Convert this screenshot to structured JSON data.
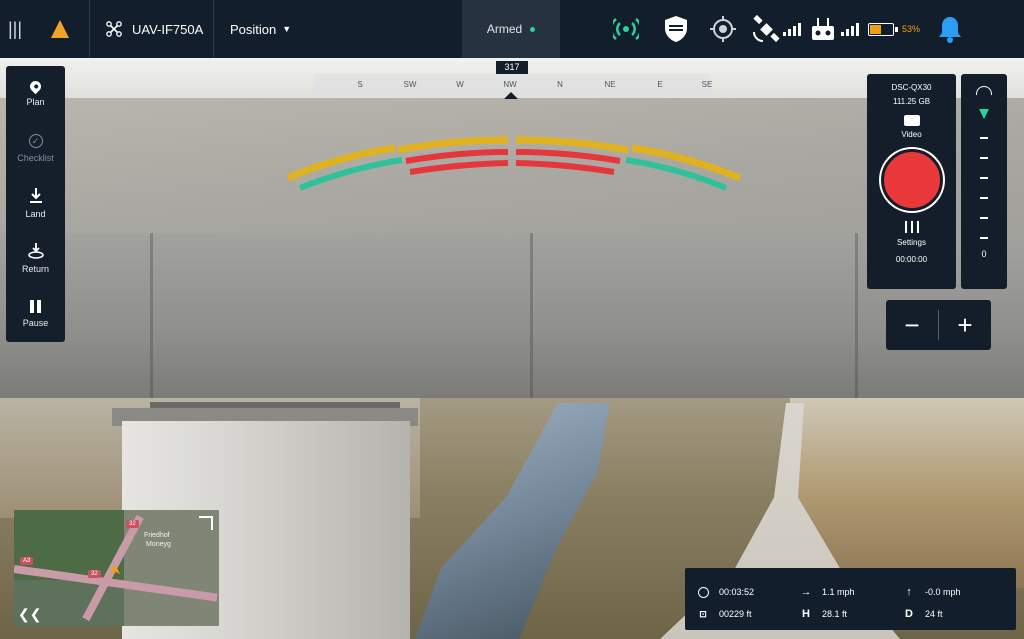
{
  "topbar": {
    "vehicle_name": "UAV-IF750A",
    "flight_mode": "Position",
    "arm_status": "Armed",
    "battery_percent": "53%",
    "battery_level": 0.53
  },
  "tools": [
    {
      "label": "Plan"
    },
    {
      "label": "Checklist"
    },
    {
      "label": "Land"
    },
    {
      "label": "Return"
    },
    {
      "label": "Pause"
    }
  ],
  "compass": {
    "heading": "317",
    "marks": [
      "S",
      "SW",
      "W",
      "NW",
      "N",
      "NE",
      "E",
      "SE"
    ]
  },
  "camera": {
    "model": "DSC-QX30",
    "storage": "111.25 GB",
    "mode_label": "Video",
    "settings_label": "Settings",
    "rec_time": "00:00:00"
  },
  "gimbal": {
    "value": "0"
  },
  "zoom": {
    "minus": "−",
    "plus": "+"
  },
  "minimap": {
    "labels": {
      "area1": "Friedhof",
      "area2": "Moneyg",
      "road_a": "A3",
      "road_b": "32",
      "road_c": "32"
    }
  },
  "telemetry": {
    "flight_time": "00:03:52",
    "distance": "00229 ft",
    "h_speed": "1.1 mph",
    "altitude": "28.1 ft",
    "v_speed": "-0.0 mph",
    "home_dist": "24 ft"
  },
  "colors": {
    "accent_green": "#2bd39a",
    "warn_yellow": "#e0b21f",
    "alert_red": "#e4363b",
    "record_red": "#e8383a",
    "panel_bg": "#131e2a"
  }
}
